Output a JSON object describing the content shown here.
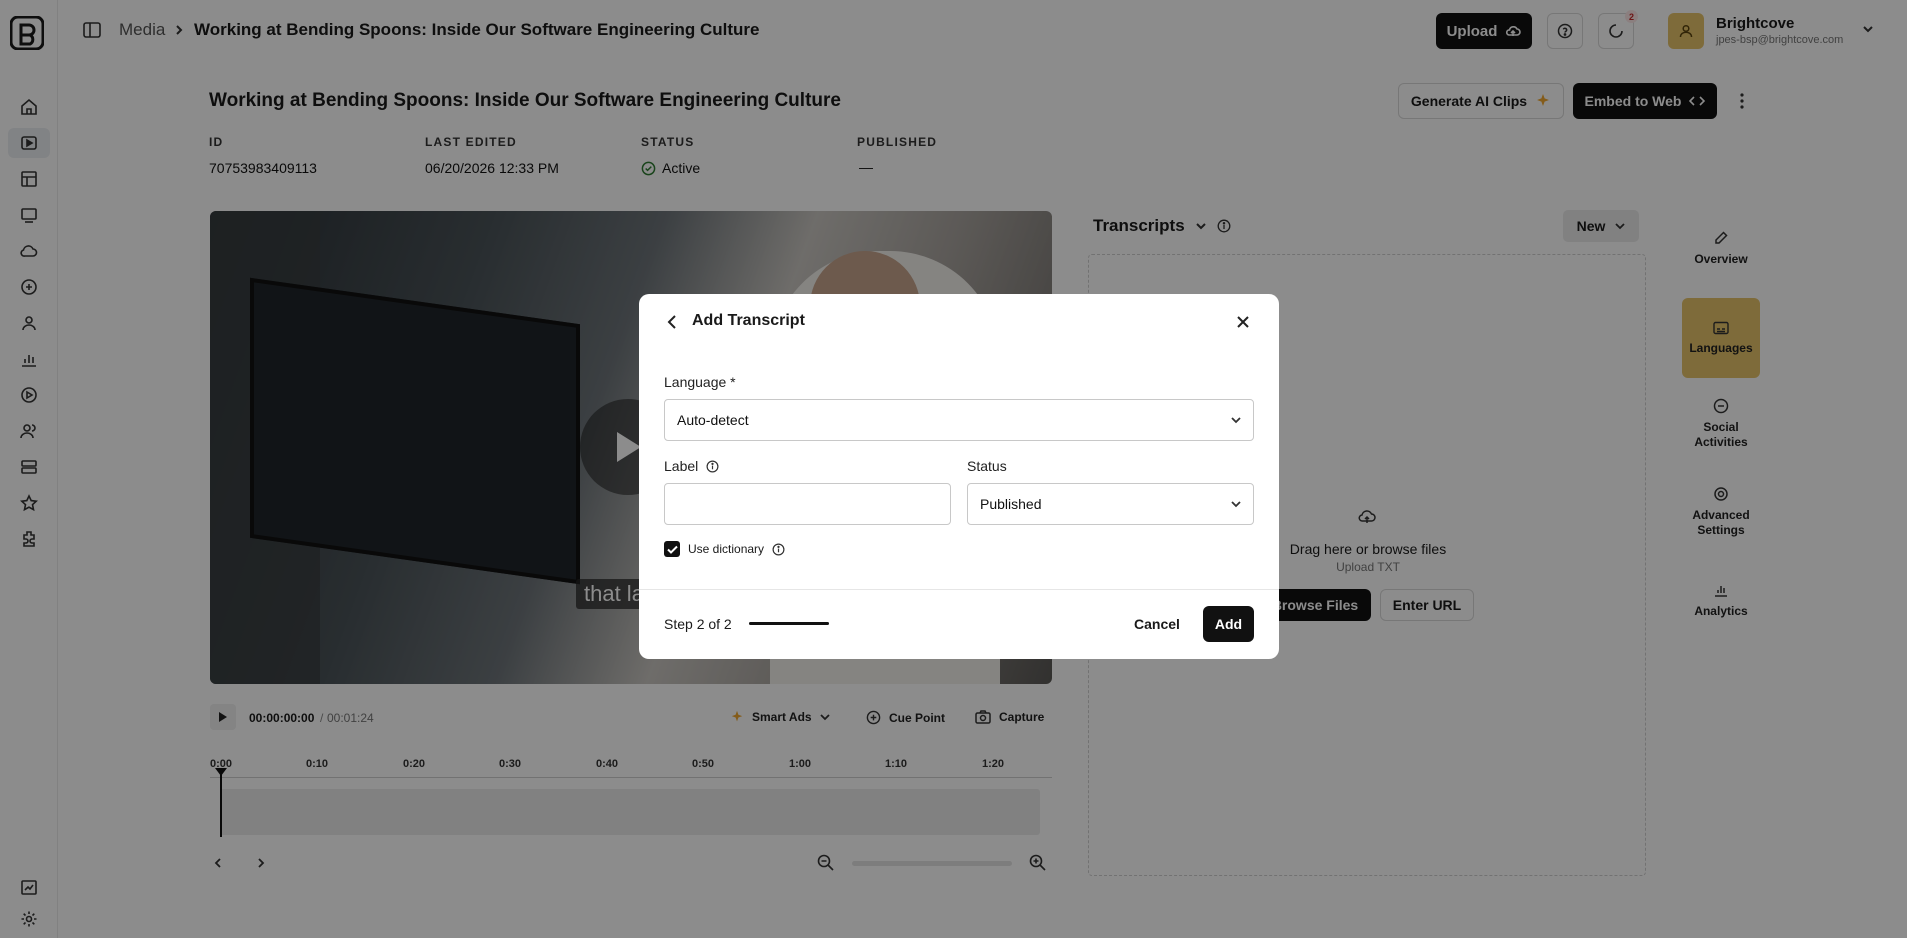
{
  "header": {
    "breadcrumb_root": "Media",
    "breadcrumb_current": "Working at Bending Spoons: Inside Our Software Engineering Culture",
    "upload_label": "Upload",
    "notification_count": "2",
    "account_name": "Brightcove",
    "account_email": "jpes-bsp@brightcove.com"
  },
  "page": {
    "title": "Working at Bending Spoons: Inside Our Software Engineering Culture",
    "generate_ai_label": "Generate AI Clips",
    "embed_label": "Embed to Web",
    "meta": [
      {
        "label": "ID",
        "value": "70753983409113"
      },
      {
        "label": "LAST EDITED",
        "value": "06/20/2026 12:33 PM"
      },
      {
        "label": "STATUS",
        "value": "Active"
      },
      {
        "label": "PUBLISHED",
        "value": "—"
      }
    ]
  },
  "video": {
    "caption": "that la",
    "current_time": "00:00:00:00",
    "duration": "00:01:24",
    "smart_ads_label": "Smart Ads",
    "cue_point_label": "Cue Point",
    "capture_label": "Capture",
    "timeline_ticks": [
      "0:00",
      "0:10",
      "0:20",
      "0:30",
      "0:40",
      "0:50",
      "1:00",
      "1:10",
      "1:20"
    ]
  },
  "transcripts": {
    "title": "Transcripts",
    "new_label": "New",
    "drop_text": "Drag here or browse files",
    "drop_sub": "Upload TXT",
    "browse_label": "Browse Files",
    "url_label": "Enter URL"
  },
  "side_tabs": [
    {
      "label": "Overview",
      "icon": "pencil-icon"
    },
    {
      "label": "Languages",
      "icon": "captions-icon",
      "active": true
    },
    {
      "label": "Social Activities",
      "icon": "social-icon"
    },
    {
      "label": "Advanced Settings",
      "icon": "gear-icon"
    },
    {
      "label": "Analytics",
      "icon": "chart-icon"
    }
  ],
  "modal": {
    "title": "Add Transcript",
    "language_label": "Language *",
    "language_value": "Auto-detect",
    "label_label": "Label",
    "label_value": "",
    "status_label": "Status",
    "status_value": "Published",
    "dictionary_label": "Use dictionary",
    "dictionary_checked": true,
    "step_text": "Step 2 of 2",
    "step_progress": 1.0,
    "cancel_label": "Cancel",
    "add_label": "Add"
  },
  "colors": {
    "accent_gold": "#e6c36a",
    "dark_button": "#111111",
    "active_green": "#2e7d32"
  }
}
